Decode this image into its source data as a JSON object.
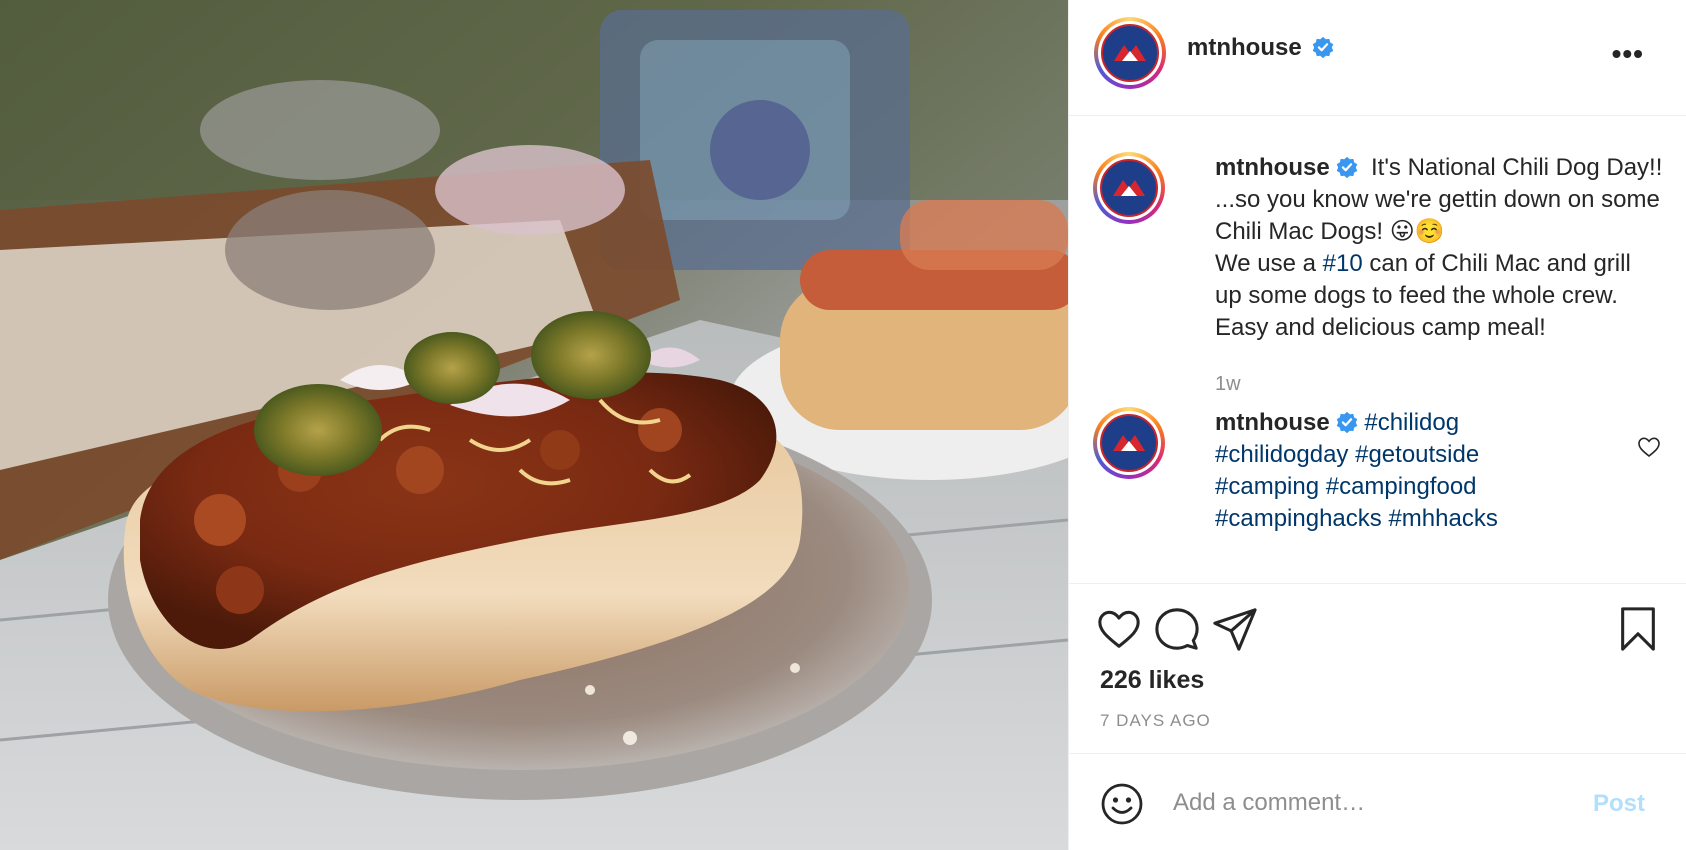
{
  "photo": {
    "icon": "chili-dog-photo"
  },
  "header": {
    "username": "mtnhouse",
    "verified_icon": "verified-badge-icon",
    "more_label": "•••"
  },
  "caption": {
    "username": "mtnhouse",
    "text_part1": "It's National Chili Dog Day!! ...so you know we're gettin down on some Chili Mac Dogs! 😛☺️\nWe use a ",
    "hashtag": "#10",
    "text_part2": " can of Chili Mac and grill up some dogs to feed the whole crew. Easy and delicious camp meal!",
    "time": "1w"
  },
  "hashtag_comment": {
    "username": "mtnhouse",
    "tags": [
      "#chilidog",
      "#chilidogday",
      "#getoutside",
      "#camping",
      "#campingfood",
      "#campinghacks",
      "#mhhacks"
    ]
  },
  "actions": {
    "like_icon": "heart-icon",
    "comment_icon": "comment-icon",
    "share_icon": "paper-plane-icon",
    "save_icon": "bookmark-icon",
    "likes": "226 likes",
    "date": "7 DAYS AGO"
  },
  "comment_box": {
    "placeholder": "Add a comment…",
    "post_label": "Post"
  },
  "colors": {
    "link": "#00376b",
    "verified": "#3897f0",
    "post_disabled": "#b2dffc",
    "muted": "#8e8e8e"
  }
}
